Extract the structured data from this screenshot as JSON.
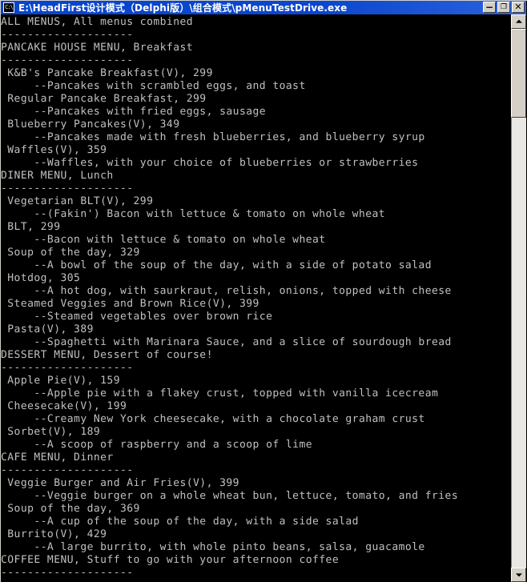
{
  "window": {
    "title": "E:\\HeadFirst设计模式（Delphi版）\\组合模式\\pMenuTestDrive.exe",
    "sysmenu_icon_text": "C:\\",
    "buttons": {
      "minimize": "−",
      "restore": "❐",
      "close": "✕"
    }
  },
  "console": {
    "lines": [
      "ALL MENUS, All menus combined",
      "--------------------",
      "PANCAKE HOUSE MENU, Breakfast",
      "--------------------",
      " K&B's Pancake Breakfast(V), 299",
      "     --Pancakes with scrambled eggs, and toast",
      " Regular Pancake Breakfast, 299",
      "     --Pancakes with fried eggs, sausage",
      " Blueberry Pancakes(V), 349",
      "     --Pancakes made with fresh blueberries, and blueberry syrup",
      " Waffles(V), 359",
      "     --Waffles, with your choice of blueberries or strawberries",
      "DINER MENU, Lunch",
      "--------------------",
      " Vegetarian BLT(V), 299",
      "     --(Fakin') Bacon with lettuce & tomato on whole wheat",
      " BLT, 299",
      "     --Bacon with lettuce & tomato on whole wheat",
      " Soup of the day, 329",
      "     --A bowl of the soup of the day, with a side of potato salad",
      " Hotdog, 305",
      "     --A hot dog, with saurkraut, relish, onions, topped with cheese",
      " Steamed Veggies and Brown Rice(V), 399",
      "     --Steamed vegetables over brown rice",
      " Pasta(V), 389",
      "     --Spaghetti with Marinara Sauce, and a slice of sourdough bread",
      "DESSERT MENU, Dessert of course!",
      "--------------------",
      " Apple Pie(V), 159",
      "     --Apple pie with a flakey crust, topped with vanilla icecream",
      " Cheesecake(V), 199",
      "     --Creamy New York cheesecake, with a chocolate graham crust",
      " Sorbet(V), 189",
      "     --A scoop of raspberry and a scoop of lime",
      "CAFE MENU, Dinner",
      "--------------------",
      " Veggie Burger and Air Fries(V), 399",
      "     --Veggie burger on a whole wheat bun, lettuce, tomato, and fries",
      " Soup of the day, 369",
      "     --A cup of the soup of the day, with a side salad",
      " Burrito(V), 429",
      "     --A large burrito, with whole pinto beans, salsa, guacamole",
      "COFFEE MENU, Stuff to go with your afternoon coffee",
      "--------------------"
    ]
  },
  "scrollbar": {
    "up_arrow": "▲",
    "down_arrow": "▼"
  },
  "colors": {
    "titlebar": "#0a46ce",
    "console_bg": "#000000",
    "console_fg": "#c0c0c0",
    "chrome": "#d4d0c8"
  }
}
